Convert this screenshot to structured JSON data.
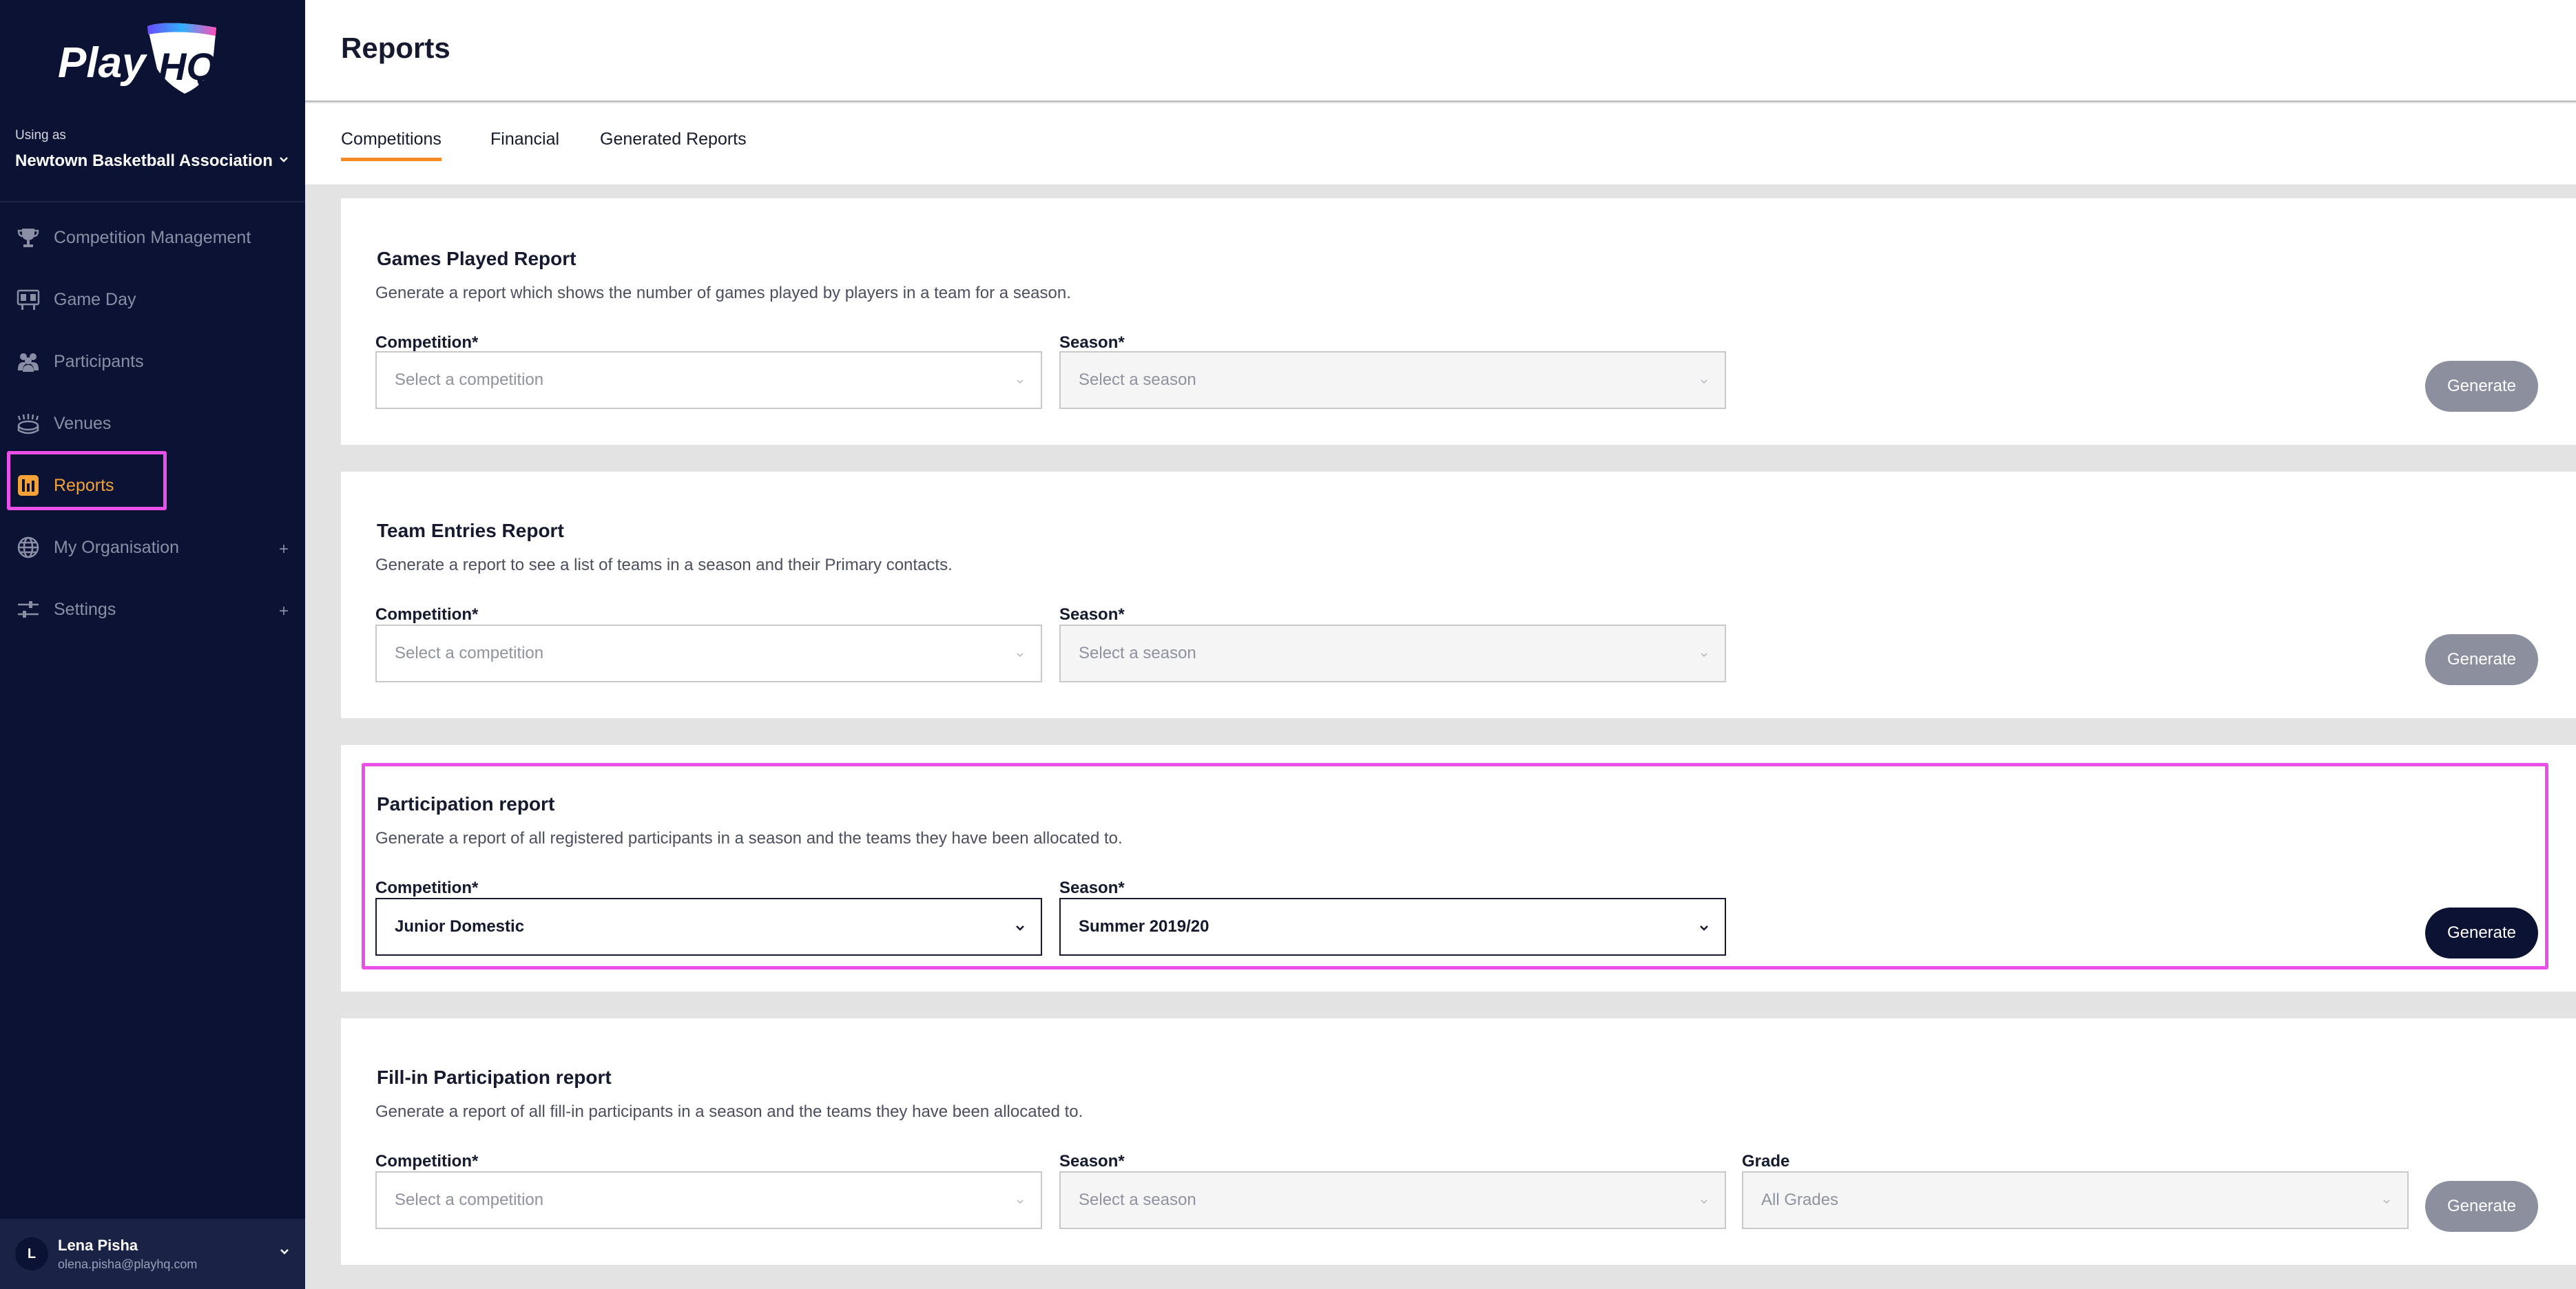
{
  "app": {
    "logo_text": "PlayHQ",
    "brand_colors": {
      "sidebar": "#0b1233",
      "accent": "#f48a21",
      "active_nav": "#f4a238",
      "highlight": "#ea4fe8"
    }
  },
  "sidebar": {
    "using_as_label": "Using as",
    "organisation": "Newtown Basketball Association",
    "items": [
      {
        "label": "Competition Management",
        "icon": "trophy-icon",
        "active": false,
        "expandable": false
      },
      {
        "label": "Game Day",
        "icon": "scoreboard-icon",
        "active": false,
        "expandable": false
      },
      {
        "label": "Participants",
        "icon": "participants-icon",
        "active": false,
        "expandable": false
      },
      {
        "label": "Venues",
        "icon": "stadium-icon",
        "active": false,
        "expandable": false
      },
      {
        "label": "Reports",
        "icon": "reports-icon",
        "active": true,
        "expandable": false
      },
      {
        "label": "My Organisation",
        "icon": "globe-icon",
        "active": false,
        "expandable": true
      },
      {
        "label": "Settings",
        "icon": "sliders-icon",
        "active": false,
        "expandable": true
      }
    ],
    "user": {
      "initial": "L",
      "name": "Lena Pisha",
      "email": "olena.pisha@playhq.com"
    }
  },
  "header": {
    "title": "Reports"
  },
  "tabs": [
    {
      "label": "Competitions",
      "active": true
    },
    {
      "label": "Financial",
      "active": false
    },
    {
      "label": "Generated Reports",
      "active": false
    }
  ],
  "reports": [
    {
      "title": "Games Played Report",
      "description": "Generate a report which shows the number of games played by players in a team for a season.",
      "competition_label": "Competition*",
      "competition_value": "Select a competition",
      "season_label": "Season*",
      "season_value": "Select a season",
      "button": "Generate"
    },
    {
      "title": "Team Entries Report",
      "description": "Generate a report to see a list of teams in a season and their Primary contacts.",
      "competition_label": "Competition*",
      "competition_value": "Select a competition",
      "season_label": "Season*",
      "season_value": "Select a season",
      "button": "Generate"
    },
    {
      "title": "Participation report",
      "description": "Generate a report of all registered participants in a season and the teams they have been allocated to.",
      "competition_label": "Competition*",
      "competition_value": "Junior Domestic",
      "season_label": "Season*",
      "season_value": "Summer 2019/20",
      "button": "Generate"
    },
    {
      "title": "Fill-in Participation report",
      "description": "Generate a report of all fill-in participants in a season and the teams they have been allocated to.",
      "competition_label": "Competition*",
      "competition_value": "Select a competition",
      "season_label": "Season*",
      "season_value": "Select a season",
      "grade_label": "Grade",
      "grade_value": "All Grades",
      "button": "Generate"
    }
  ]
}
